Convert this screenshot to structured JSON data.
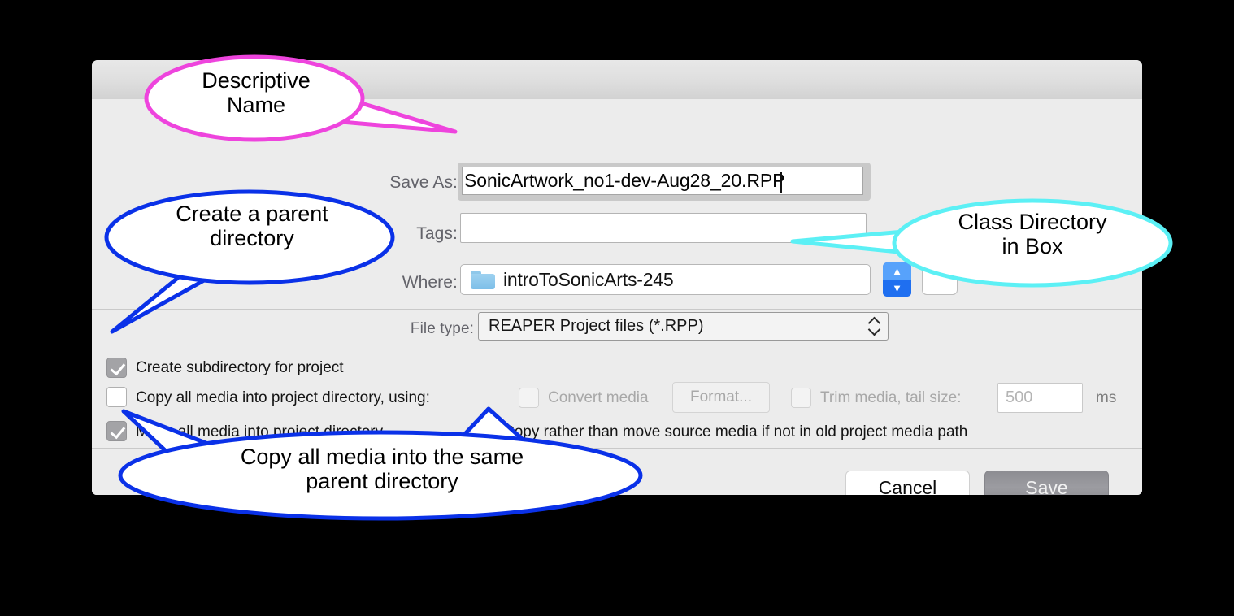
{
  "dialog": {
    "fields": {
      "save_as_label": "Save As:",
      "save_as_value": "SonicArtwork_no1-dev-Aug28_20.RPP",
      "tags_label": "Tags:",
      "tags_value": "",
      "where_label": "Where:",
      "where_value": "introToSonicArts-245",
      "file_type_label": "File type:",
      "file_type_value": "REAPER Project files (*.RPP)"
    },
    "checkboxes": {
      "create_subdirectory": {
        "label": "Create subdirectory for project",
        "state": "checked",
        "enabled": true
      },
      "copy_all_media": {
        "label": "Copy all media into project directory, using:",
        "state": "unchecked",
        "enabled": true
      },
      "move_all_media": {
        "label": "Move all media into project directory",
        "state": "checked",
        "enabled": true
      },
      "copy_rather_than_move": {
        "label": "Copy rather than move source media if not in old project media path",
        "state": "checked",
        "enabled": true
      },
      "convert_media": {
        "label": "Convert media",
        "state": "unchecked",
        "enabled": false
      },
      "trim_media": {
        "label": "Trim media, tail size:",
        "state": "unchecked",
        "enabled": false
      }
    },
    "format_button_label": "Format...",
    "trim_value": "500",
    "trim_units": "ms",
    "buttons": {
      "cancel": "Cancel",
      "save": "Save"
    }
  },
  "annotations": [
    {
      "id": "descriptive-name",
      "text": "Descriptive\nName",
      "color": "#ee44dd",
      "points_to": "save-as-field"
    },
    {
      "id": "create-parent-directory",
      "text": "Create a parent\ndirectory",
      "color": "#0a31e8",
      "points_to": "create-subdirectory-checkbox"
    },
    {
      "id": "class-directory-in-box",
      "text": "Class Directory\nin Box",
      "color": "#5cf0f5",
      "points_to": "where-field"
    },
    {
      "id": "copy-all-media-same-parent",
      "text": "Copy all media into the same\nparent directory",
      "color": "#0a31e8",
      "points_to": "move-and-copy-checkboxes"
    }
  ],
  "icons": {
    "folder": "folder-icon",
    "stepper_up": "chevron-up-icon",
    "stepper_down": "chevron-down-icon",
    "filetype_chevrons": "chevron-up-down-icon"
  }
}
